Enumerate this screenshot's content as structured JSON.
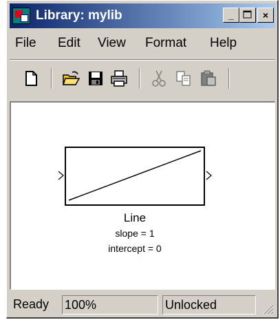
{
  "window": {
    "title": "Library: mylib",
    "icon": "simulink-library-icon",
    "controls": {
      "minimize": "_",
      "maximize": "□",
      "close": "×"
    }
  },
  "menu": {
    "items": [
      {
        "label": "File"
      },
      {
        "label": "Edit"
      },
      {
        "label": "View"
      },
      {
        "label": "Format"
      },
      {
        "label": "Help"
      }
    ]
  },
  "toolbar": {
    "items": [
      {
        "icon": "new-document-icon"
      },
      {
        "icon": "open-folder-icon"
      },
      {
        "icon": "save-icon"
      },
      {
        "icon": "print-icon"
      },
      {
        "icon": "cut-icon",
        "enabled": false
      },
      {
        "icon": "copy-icon",
        "enabled": false
      },
      {
        "icon": "paste-icon",
        "enabled": false
      }
    ]
  },
  "block": {
    "name": "Line",
    "params": [
      "slope = 1",
      "intercept = 0"
    ]
  },
  "status": {
    "state": "Ready",
    "zoom": "100%",
    "lock": "Unlocked"
  }
}
